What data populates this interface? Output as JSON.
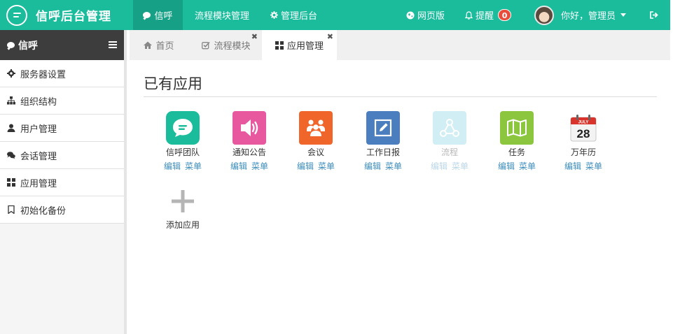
{
  "brand": {
    "title": "信呼后台管理"
  },
  "topnav": {
    "items": [
      {
        "label": "信呼",
        "icon": "chat-bubble-icon",
        "active": true
      },
      {
        "label": "流程模块管理",
        "icon": "",
        "active": false
      },
      {
        "label": "管理后台",
        "icon": "gear-icon",
        "active": false
      }
    ],
    "web_label": "网页版",
    "alert_label": "提醒",
    "alert_count": "0",
    "user_greeting": "你好，管理员"
  },
  "sidebar": {
    "title": "信呼",
    "items": [
      {
        "label": "服务器设置",
        "icon": "gear-icon"
      },
      {
        "label": "组织结构",
        "icon": "sitemap-icon"
      },
      {
        "label": "用户管理",
        "icon": "user-icon"
      },
      {
        "label": "会话管理",
        "icon": "comments-icon"
      },
      {
        "label": "应用管理",
        "icon": "grid-icon"
      },
      {
        "label": "初始化备份",
        "icon": "bookmark-icon"
      }
    ]
  },
  "tabs": [
    {
      "label": "首页",
      "icon": "home-icon",
      "closable": false,
      "active": false
    },
    {
      "label": "流程模块",
      "icon": "check-square-icon",
      "closable": true,
      "active": false
    },
    {
      "label": "应用管理",
      "icon": "grid-icon",
      "closable": true,
      "active": true
    }
  ],
  "main": {
    "title": "已有应用",
    "edit_label": "编辑",
    "menu_label": "菜单",
    "apps": [
      {
        "name": "信呼团队",
        "color": "#1abc9c",
        "icon": "chat-icon",
        "disabled": false
      },
      {
        "name": "通知公告",
        "color": "#e8589f",
        "icon": "speaker-icon",
        "disabled": false
      },
      {
        "name": "会议",
        "color": "#f0662a",
        "icon": "people-icon",
        "disabled": false
      },
      {
        "name": "工作日报",
        "color": "#4a7ebf",
        "icon": "edit-icon",
        "disabled": false
      },
      {
        "name": "流程",
        "color": "#7ed0e0",
        "icon": "flow-icon",
        "disabled": true
      },
      {
        "name": "任务",
        "color": "#8cc63f",
        "icon": "map-icon",
        "disabled": false
      },
      {
        "name": "万年历",
        "color": "#ffffff",
        "icon": "calendar-icon",
        "disabled": false,
        "calendar_month": "JULY",
        "calendar_day": "28"
      }
    ],
    "add_label": "添加应用"
  }
}
